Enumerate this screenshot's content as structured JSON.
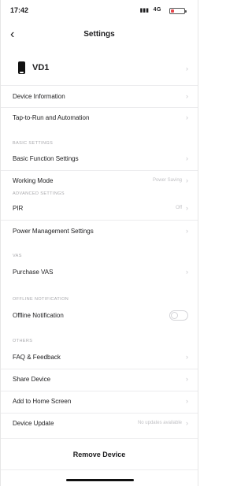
{
  "status_bar": {
    "time": "17:42",
    "network": "4G",
    "battery_color": "#e5484d",
    "battery_level": 0.2
  },
  "nav": {
    "back_icon": "chevron-left-icon",
    "title": "Settings"
  },
  "device": {
    "name": "VD1",
    "icon": "phone-icon"
  },
  "top_rows": [
    {
      "label": "Device Information"
    },
    {
      "label": "Tap-to-Run and Automation"
    }
  ],
  "basic": {
    "header": "BASIC SETTINGS",
    "rows": [
      {
        "label": "Basic Function Settings"
      },
      {
        "label": "Working Mode",
        "value": "Power Saving"
      }
    ]
  },
  "advanced": {
    "header": "ADVANCED SETTINGS",
    "rows": [
      {
        "label": "PIR",
        "value": "Off"
      },
      {
        "label": "Power Management Settings"
      }
    ]
  },
  "vas": {
    "header": "VAS",
    "rows": [
      {
        "label": "Purchase VAS"
      }
    ]
  },
  "offline": {
    "header": "OFFLINE NOTIFICATION",
    "rows": [
      {
        "label": "Offline Notification",
        "toggle": false
      }
    ]
  },
  "others": {
    "header": "OTHERS",
    "rows": [
      {
        "label": "FAQ & Feedback"
      },
      {
        "label": "Share Device"
      },
      {
        "label": "Add to Home Screen"
      },
      {
        "label": "Device Update",
        "value": "No updates available"
      }
    ]
  },
  "remove_label": "Remove Device"
}
